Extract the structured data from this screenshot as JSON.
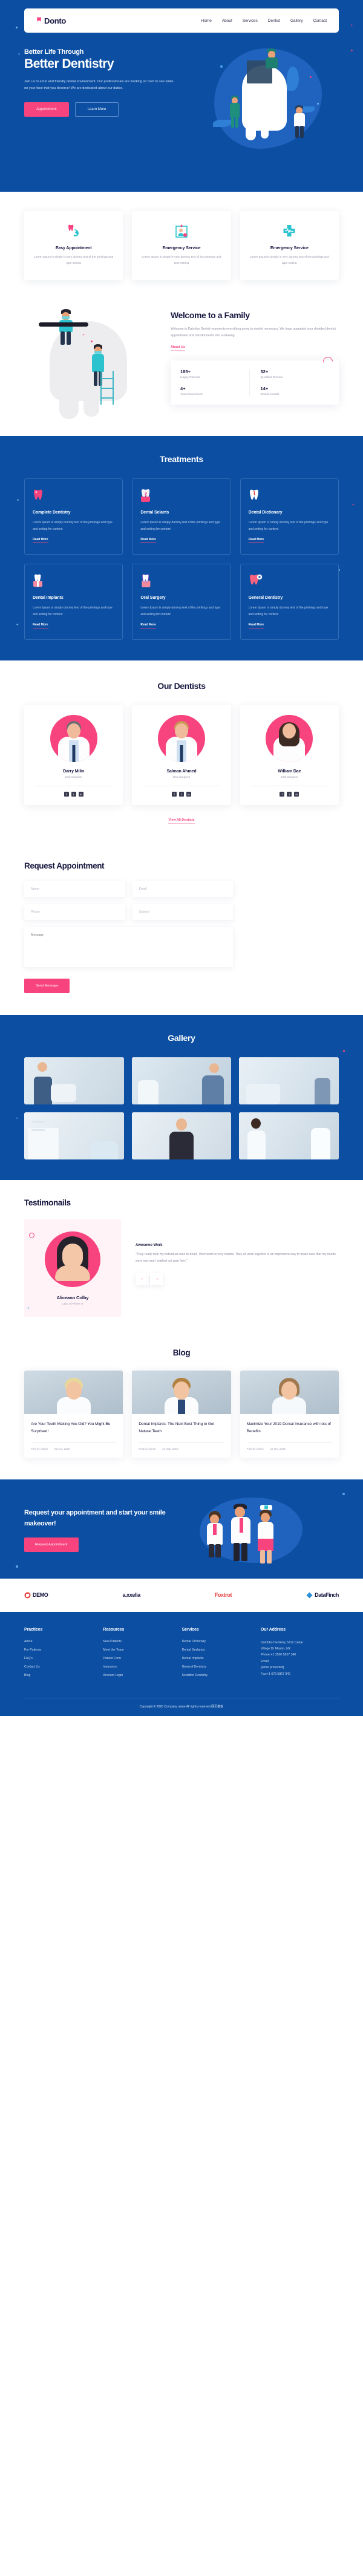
{
  "brand": {
    "name": "Donto",
    "mark": "tooth-icon"
  },
  "nav": {
    "items": [
      "Home",
      "About",
      "Services",
      "Dentist",
      "Gallery",
      "Contact"
    ]
  },
  "hero": {
    "eyebrow": "Better Life Through",
    "title": "Better Dentistry",
    "text": "Join us to a fun and friendly dental environment. Our professionals are working so hard to see smile on your face that you deserve! We are dedicated about our duties.",
    "primary_button": "Appointment",
    "secondary_button": "Learn More"
  },
  "features": [
    {
      "icon": "tooth-phone-icon",
      "title": "Easy Appointment",
      "text": "Lorem Ipsum is simply is very dummy text of the printings and type setting"
    },
    {
      "icon": "doctor-card-icon",
      "title": "Emergency Service",
      "text": "Lorem Ipsum is simply is very dummy text of the printings and type setting"
    },
    {
      "icon": "medical-cross-icon",
      "title": "Emergency Service",
      "text": "Lorem Ipsum is simply is very dummy text of the printings and type setting"
    }
  ],
  "welcome": {
    "title": "Welcome to a Family",
    "text": "Welcome to Datobbo Dental represents everything going to dentist necessary. We have upgraded your dreaded dentist appointment and transformed it into a relaxing.",
    "link": "About Us",
    "stats": [
      {
        "number": "185+",
        "label": "Happy Patients"
      },
      {
        "number": "32+",
        "label": "Qualified Doctors"
      },
      {
        "number": "4+",
        "label": "Years Experience"
      },
      {
        "number": "14+",
        "label": "Dental Awards"
      }
    ]
  },
  "treatments": {
    "title": "Treatments",
    "read_more": "Read More",
    "items": [
      {
        "icon": "pink-tooth-icon",
        "title": "Complete Dentistry",
        "text": "Lorem Ipsum is simply dummy text of the printings and type and setting for content"
      },
      {
        "icon": "sealant-tooth-icon",
        "title": "Dental Selants",
        "text": "Lorem Ipsum is simply dummy text of the printings and type and setting for content"
      },
      {
        "icon": "cracked-tooth-icon",
        "title": "Dental Dictionary",
        "text": "Lorem Ipsum is simply dummy text of the printings and type and setting for content"
      },
      {
        "icon": "implant-tooth-icon",
        "title": "Dental Implants",
        "text": "Lorem Ipsum is simply dummy text of the printings and type and setting for content"
      },
      {
        "icon": "surgery-tooth-icon",
        "title": "Oral Surgery",
        "text": "Lorem Ipsum is simply dummy text of the printings and type and setting for content"
      },
      {
        "icon": "tooth-plus-icon",
        "title": "General Dentistry",
        "text": "Lorem Ipsum is simply dummy text of the printings and type and setting for content"
      }
    ]
  },
  "dentists": {
    "title": "Our Dentists",
    "view_all": "View All Dentists",
    "items": [
      {
        "name": "Darry Milin",
        "role": "Oral Surgeon"
      },
      {
        "name": "Salman Ahmed",
        "role": "Oral Surgeon"
      },
      {
        "name": "William Dae",
        "role": "Oral Surgeon"
      }
    ],
    "socials": [
      "f",
      "t",
      "in"
    ]
  },
  "appointment": {
    "title": "Request Appointment",
    "fields": {
      "name": "Name",
      "email": "Email",
      "phone": "Phone",
      "subject": "Subject",
      "message": "Message"
    },
    "submit": "Send Message"
  },
  "gallery": {
    "title": "Gallery",
    "items": [
      "dentist-treating-patient",
      "dentist-with-patient-chair",
      "dental-clinic-room",
      "dental-equipment-cabinet",
      "dentist-standing-portrait",
      "dentist-handshake-patient"
    ]
  },
  "testimonials": {
    "title": "Testimonails",
    "heading": "Awesome Work",
    "quote": "\"They really took my individual case to heart. Their team is very helpful. They all work together in an impressive way to make sure that my needs were met and I walked out pain free.\"",
    "author": "Aliceano Colby",
    "author_role": "CEO of Prime IT",
    "prev": "←",
    "next": "→"
  },
  "blog": {
    "title": "Blog",
    "posts": [
      {
        "title": "Are Your Teeth Making You Old? You Might Be Surprised!",
        "author": "Post by Admin",
        "date": "02 Jun, 2019"
      },
      {
        "title": "Dental Implants: The Next Best Thing to Get Natural Teeth",
        "author": "Post by Admin",
        "date": "24 Sep, 2019"
      },
      {
        "title": "Maximize Your 2019 Dental Insurance with lots of Benefits",
        "author": "Post by Admin",
        "date": "12 Oct, 2019"
      }
    ]
  },
  "cta": {
    "heading": "Request your appointment and start your smile makeover!",
    "button": "Request Appointment"
  },
  "brands": [
    {
      "name": "DEMO",
      "color": "#e8413f"
    },
    {
      "name": "a.xxelia",
      "color": "#16163f"
    },
    {
      "name": "Foxtrot",
      "color": "#e8413f"
    },
    {
      "name": "DataFinch",
      "color": "#16163f"
    }
  ],
  "footer": {
    "columns": [
      {
        "heading": "Practices",
        "links": [
          "About",
          "For Patients",
          "FAQ's",
          "Contact Us",
          "Blog"
        ]
      },
      {
        "heading": "Resources",
        "links": [
          "New Patients",
          "Meet the Team",
          "Patient Form",
          "Insurance",
          "Account Login"
        ]
      },
      {
        "heading": "Services",
        "links": [
          "Dental Dictionary",
          "Dental Sealands",
          "Dental Implants",
          "General Dentistry",
          "Sedation Dentistry"
        ]
      }
    ],
    "address": {
      "heading": "Our Address",
      "lines": [
        "Datobbo Dentistry 5212 Cedar",
        "Village Dr Mason, NY.",
        "Phone:+1 3500 5857 340",
        "Email:",
        "[email protected]",
        "Fax:+1 675 5867 340"
      ]
    },
    "copyright": "Copyright © 2020 Company name All rights reserved.网页模板"
  },
  "colors": {
    "blue": "#0b4ea2",
    "pink": "#f8447e",
    "dark": "#16163f",
    "teal": "#3fb6c4"
  }
}
